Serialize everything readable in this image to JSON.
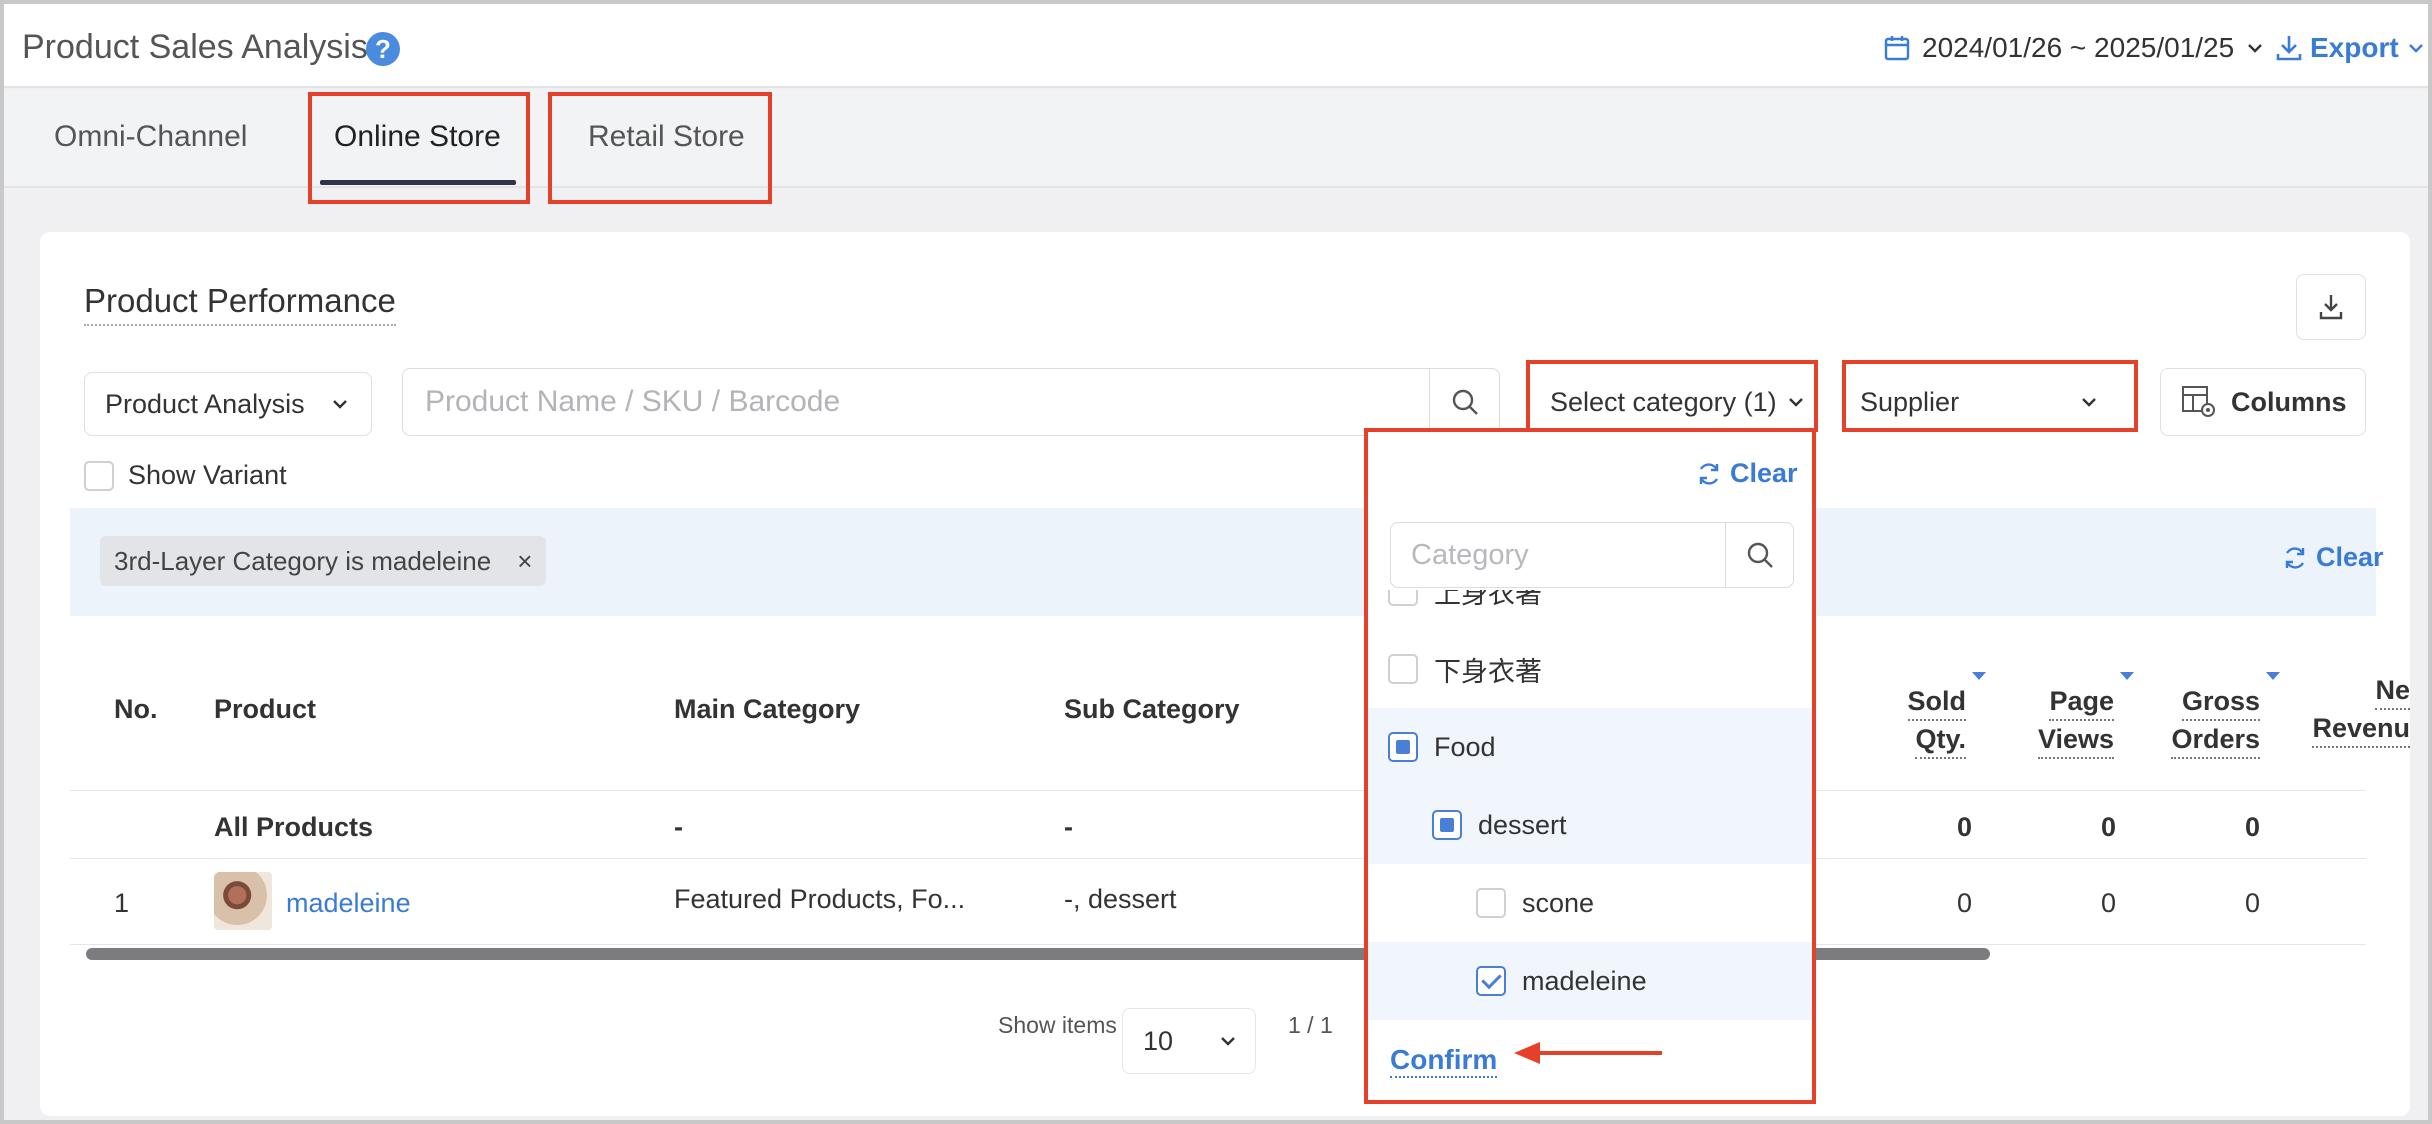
{
  "header": {
    "title": "Product Sales Analysis",
    "help_icon": "question-circle-icon",
    "date_range": "2024/01/26 ~ 2025/01/25",
    "export_label": "Export"
  },
  "tabs": [
    {
      "label": "Omni-Channel"
    },
    {
      "label": "Online Store",
      "active": true
    },
    {
      "label": "Retail Store"
    }
  ],
  "card": {
    "title": "Product Performance",
    "analysis_select": "Product Analysis",
    "search_placeholder": "Product Name / SKU / Barcode",
    "category_select": "Select category (1)",
    "supplier_select": "Supplier",
    "columns_label": "Columns",
    "show_variant_label": "Show Variant",
    "filter_chip": "3rd-Layer Category is madeleine",
    "filter_chip_close": "×",
    "clear_label": "Clear"
  },
  "table": {
    "headers": {
      "no": "No.",
      "product": "Product",
      "main_category": "Main Category",
      "sub_category": "Sub Category",
      "sold_qty_1": "Sold",
      "sold_qty_2": "Qty.",
      "page_views_1": "Page",
      "page_views_2": "Views",
      "gross_orders_1": "Gross",
      "gross_orders_2": "Orders",
      "net_revenue_1": "Ne",
      "net_revenue_2": "Revenu"
    },
    "rows": [
      {
        "no": "",
        "product": "All Products",
        "main_category": "-",
        "sub_category": "-",
        "sold_qty": "0",
        "page_views": "0",
        "gross_orders": "0"
      },
      {
        "no": "1",
        "product": "madeleine",
        "main_category": "Featured Products, Fo...",
        "sub_category": "-, dessert",
        "sold_qty": "0",
        "page_views": "0",
        "gross_orders": "0"
      }
    ]
  },
  "pagination": {
    "show_items_label": "Show items",
    "page_size": "10",
    "page_indicator": "1 / 1"
  },
  "category_dropdown": {
    "clear_label": "Clear",
    "search_placeholder": "Category",
    "items": [
      {
        "label": "上身衣著",
        "state": "unchecked",
        "level": 0
      },
      {
        "label": "下身衣著",
        "state": "unchecked",
        "level": 0
      },
      {
        "label": "Food",
        "state": "partial",
        "level": 0
      },
      {
        "label": "dessert",
        "state": "partial",
        "level": 1
      },
      {
        "label": "scone",
        "state": "unchecked",
        "level": 2
      },
      {
        "label": "madeleine",
        "state": "checked",
        "level": 2
      }
    ],
    "confirm_label": "Confirm"
  },
  "colors": {
    "accent": "#3a7bd5",
    "highlight_box": "#e5412a",
    "filter_bar": "#edf3fb"
  }
}
